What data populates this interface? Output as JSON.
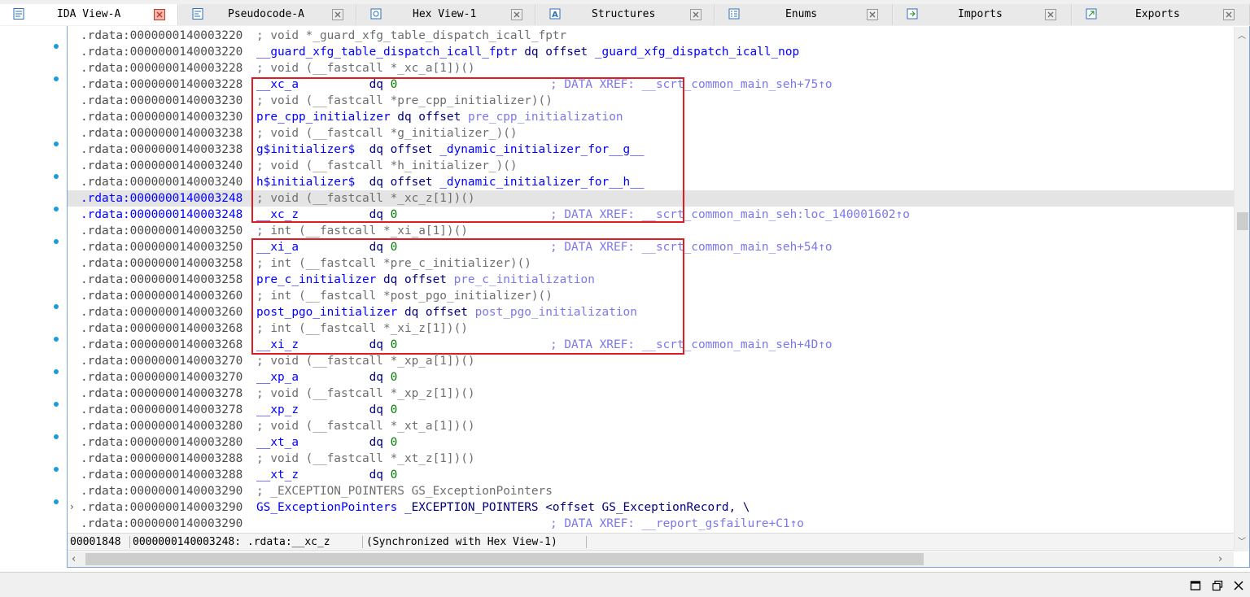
{
  "tabs": [
    {
      "label": "IDA View-A",
      "icon": "ida-view-icon",
      "active": true,
      "left": 0
    },
    {
      "label": "Pseudocode-A",
      "icon": "pseudocode-icon"
    },
    {
      "label": "Hex View-1",
      "icon": "hex-view-icon"
    },
    {
      "label": "Structures",
      "icon": "structures-icon"
    },
    {
      "label": "Enums",
      "icon": "enums-icon"
    },
    {
      "label": "Imports",
      "icon": "imports-icon"
    },
    {
      "label": "Exports",
      "icon": "exports-icon"
    }
  ],
  "listing": [
    {
      "addr": "0000000140003220",
      "parts": [
        [
          "c",
          "; void *_guard_xfg_table_dispatch_icall_fptr"
        ]
      ]
    },
    {
      "addr": "0000000140003220",
      "parts": [
        [
          "n",
          "__guard_xfg_table_dispatch_icall_fptr"
        ],
        [
          "k",
          " dq offset "
        ],
        [
          "n",
          "_guard_xfg_dispatch_icall_nop"
        ]
      ]
    },
    {
      "addr": "0000000140003228",
      "parts": [
        [
          "c",
          "; void (__fastcall *_xc_a[1])()"
        ]
      ]
    },
    {
      "addr": "0000000140003228",
      "parts": [
        [
          "n",
          "__xc_a"
        ],
        [
          "k",
          "          dq "
        ],
        [
          "d",
          "0"
        ]
      ],
      "xref": "; DATA XREF: __scrt_common_main_seh+75↑o"
    },
    {
      "addr": "0000000140003230",
      "parts": [
        [
          "c",
          "; void (__fastcall *pre_cpp_initializer)()"
        ]
      ]
    },
    {
      "addr": "0000000140003230",
      "parts": [
        [
          "n",
          "pre_cpp_initializer"
        ],
        [
          "k",
          " dq offset "
        ],
        [
          "r",
          "pre_cpp_initialization"
        ]
      ]
    },
    {
      "addr": "0000000140003238",
      "parts": [
        [
          "c",
          "; void (__fastcall *g_initializer_)()"
        ]
      ]
    },
    {
      "addr": "0000000140003238",
      "parts": [
        [
          "n",
          "g$initializer$"
        ],
        [
          "k",
          "  dq offset "
        ],
        [
          "n",
          "_dynamic_initializer_for__g__"
        ]
      ]
    },
    {
      "addr": "0000000140003240",
      "parts": [
        [
          "c",
          "; void (__fastcall *h_initializer_)()"
        ]
      ]
    },
    {
      "addr": "0000000140003240",
      "parts": [
        [
          "n",
          "h$initializer$"
        ],
        [
          "k",
          "  dq offset "
        ],
        [
          "n",
          "_dynamic_initializer_for__h__"
        ]
      ]
    },
    {
      "addr": "0000000140003248",
      "cur": true,
      "selected": true,
      "parts": [
        [
          "c",
          "; void (__fastcall *_xc_z[1])()"
        ]
      ]
    },
    {
      "addr": "0000000140003248",
      "cur": true,
      "parts": [
        [
          "n",
          "__xc_z"
        ],
        [
          "k",
          "          dq "
        ],
        [
          "d",
          "0"
        ]
      ],
      "xref": "; DATA XREF: __scrt_common_main_seh:loc_140001602↑o"
    },
    {
      "addr": "0000000140003250",
      "parts": [
        [
          "c",
          "; int (__fastcall *_xi_a[1])()"
        ]
      ]
    },
    {
      "addr": "0000000140003250",
      "parts": [
        [
          "n",
          "__xi_a"
        ],
        [
          "k",
          "          dq "
        ],
        [
          "d",
          "0"
        ]
      ],
      "xref": "; DATA XREF: __scrt_common_main_seh+54↑o"
    },
    {
      "addr": "0000000140003258",
      "parts": [
        [
          "c",
          "; int (__fastcall *pre_c_initializer)()"
        ]
      ]
    },
    {
      "addr": "0000000140003258",
      "parts": [
        [
          "n",
          "pre_c_initializer"
        ],
        [
          "k",
          " dq offset "
        ],
        [
          "r",
          "pre_c_initialization"
        ]
      ]
    },
    {
      "addr": "0000000140003260",
      "parts": [
        [
          "c",
          "; int (__fastcall *post_pgo_initializer)()"
        ]
      ]
    },
    {
      "addr": "0000000140003260",
      "parts": [
        [
          "n",
          "post_pgo_initializer"
        ],
        [
          "k",
          " dq offset "
        ],
        [
          "r",
          "post_pgo_initialization"
        ]
      ]
    },
    {
      "addr": "0000000140003268",
      "parts": [
        [
          "c",
          "; int (__fastcall *_xi_z[1])()"
        ]
      ]
    },
    {
      "addr": "0000000140003268",
      "parts": [
        [
          "n",
          "__xi_z"
        ],
        [
          "k",
          "          dq "
        ],
        [
          "d",
          "0"
        ]
      ],
      "xref": "; DATA XREF: __scrt_common_main_seh+4D↑o"
    },
    {
      "addr": "0000000140003270",
      "parts": [
        [
          "c",
          "; void (__fastcall *_xp_a[1])()"
        ]
      ]
    },
    {
      "addr": "0000000140003270",
      "parts": [
        [
          "n",
          "__xp_a"
        ],
        [
          "k",
          "          dq "
        ],
        [
          "d",
          "0"
        ]
      ]
    },
    {
      "addr": "0000000140003278",
      "parts": [
        [
          "c",
          "; void (__fastcall *_xp_z[1])()"
        ]
      ]
    },
    {
      "addr": "0000000140003278",
      "parts": [
        [
          "n",
          "__xp_z"
        ],
        [
          "k",
          "          dq "
        ],
        [
          "d",
          "0"
        ]
      ]
    },
    {
      "addr": "0000000140003280",
      "parts": [
        [
          "c",
          "; void (__fastcall *_xt_a[1])()"
        ]
      ]
    },
    {
      "addr": "0000000140003280",
      "parts": [
        [
          "n",
          "__xt_a"
        ],
        [
          "k",
          "          dq "
        ],
        [
          "d",
          "0"
        ]
      ]
    },
    {
      "addr": "0000000140003288",
      "parts": [
        [
          "c",
          "; void (__fastcall *_xt_z[1])()"
        ]
      ]
    },
    {
      "addr": "0000000140003288",
      "parts": [
        [
          "n",
          "__xt_z"
        ],
        [
          "k",
          "          dq "
        ],
        [
          "d",
          "0"
        ]
      ]
    },
    {
      "addr": "0000000140003290",
      "parts": [
        [
          "c",
          "; _EXCEPTION_POINTERS GS_ExceptionPointers"
        ]
      ]
    },
    {
      "addr": "0000000140003290",
      "expander": true,
      "parts": [
        [
          "n",
          "GS_ExceptionPointers"
        ],
        [
          "k",
          " _EXCEPTION_POINTERS <offset GS_ExceptionRecord, \\"
        ]
      ]
    },
    {
      "addr": "0000000140003290",
      "parts": [],
      "xref": "; DATA XREF: __report_gsfailure+C1↑o"
    }
  ],
  "segment": ".rdata:",
  "status": {
    "offset": "00001848",
    "location": "0000000140003248: .rdata:__xc_z",
    "sync": "(Synchronized with Hex View-1)"
  },
  "colors": {
    "highlight_box": "#e11b22",
    "name": "#0000ff",
    "comment": "#6e6e6e",
    "number": "#008000",
    "xref": "#7b78e8"
  }
}
